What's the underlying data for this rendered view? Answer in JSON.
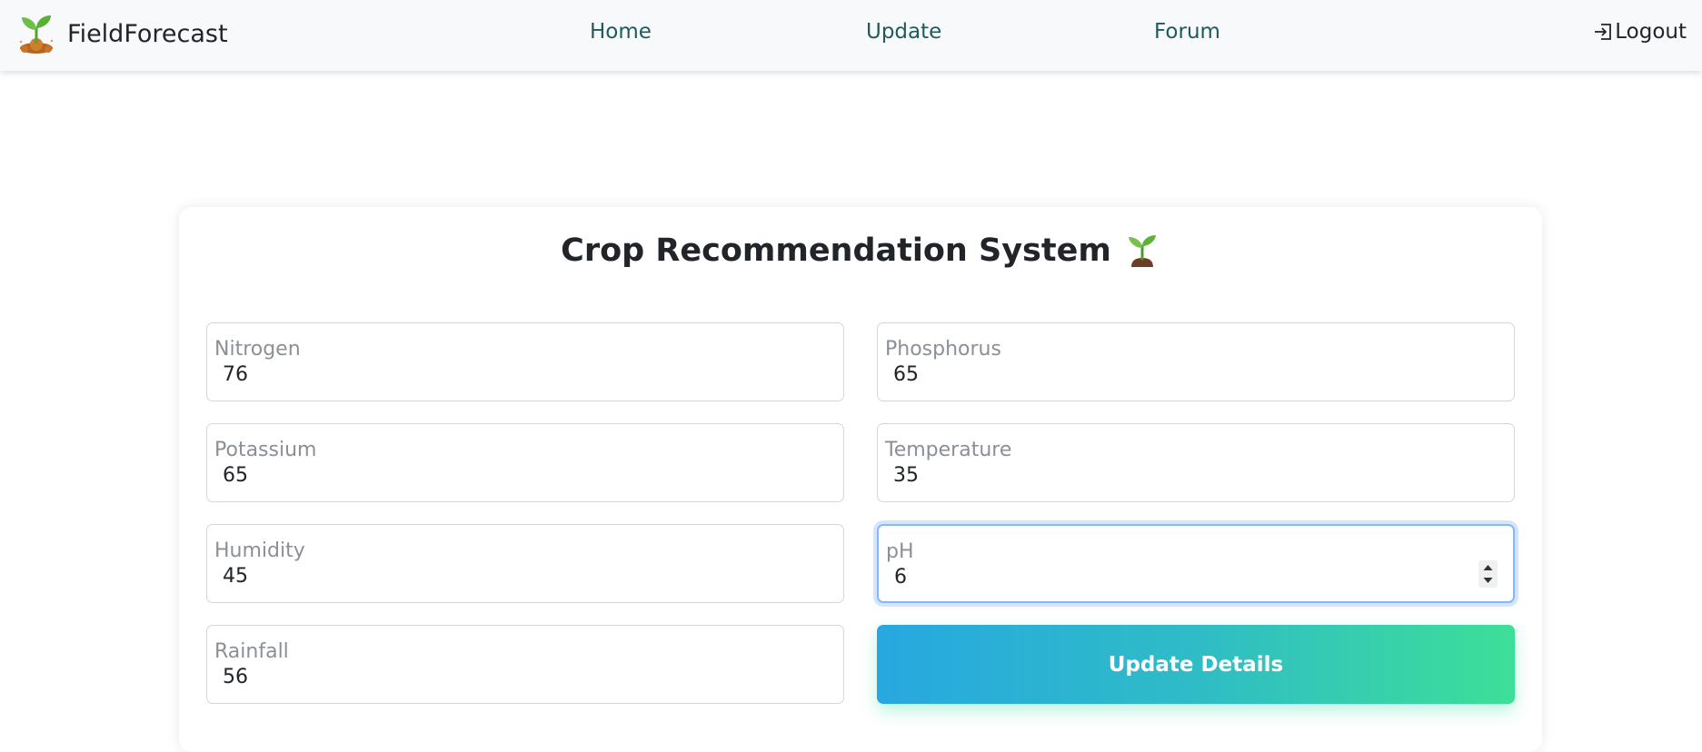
{
  "navbar": {
    "brand": "FieldForecast",
    "links": {
      "home": "Home",
      "update": "Update",
      "forum": "Forum"
    },
    "logout": "Logout"
  },
  "form": {
    "title": "Crop Recommendation System",
    "fields": {
      "nitrogen": {
        "label": "Nitrogen",
        "value": "76"
      },
      "phosphorus": {
        "label": "Phosphorus",
        "value": "65"
      },
      "potassium": {
        "label": "Potassium",
        "value": "65"
      },
      "temperature": {
        "label": "Temperature",
        "value": "35"
      },
      "humidity": {
        "label": "Humidity",
        "value": "45"
      },
      "ph": {
        "label": "pH",
        "value": "6"
      },
      "rainfall": {
        "label": "Rainfall",
        "value": "56"
      }
    },
    "submit_label": "Update Details"
  },
  "colors": {
    "navbar_bg": "#f8f9fa",
    "nav_link": "#1f5a5c",
    "button_gradient_start": "#27a8e0",
    "button_gradient_end": "#3ddf98",
    "focus_ring": "#86b7fe"
  }
}
